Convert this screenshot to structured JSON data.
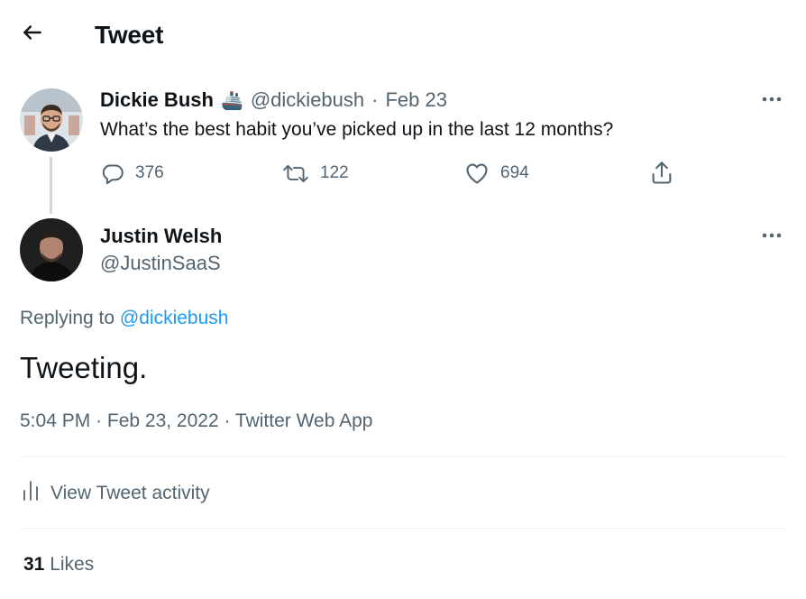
{
  "header": {
    "title": "Tweet",
    "back_icon": "arrow-left-icon"
  },
  "parent_tweet": {
    "author_name": "Dickie Bush",
    "author_emoji": "🚢",
    "handle": "@dickiebush",
    "separator": "·",
    "date": "Feb 23",
    "text": "What’s the best habit you’ve picked up in the last 12 months?",
    "replies": "376",
    "retweets": "122",
    "likes": "694"
  },
  "main_tweet": {
    "author_name": "Justin Welsh",
    "handle": "@JustinSaaS",
    "replying_prefix": "Replying to ",
    "replying_to": "@dickiebush",
    "text": "Tweeting.",
    "timestamp": "5:04 PM · Feb 23, 2022 · Twitter Web App",
    "activity_label": "View Tweet activity",
    "likes_count": "31",
    "likes_label": " Likes"
  },
  "colors": {
    "text_primary": "#0f1419",
    "text_secondary": "#536471",
    "link": "#1d9bf0",
    "divider": "#eff3f4"
  }
}
